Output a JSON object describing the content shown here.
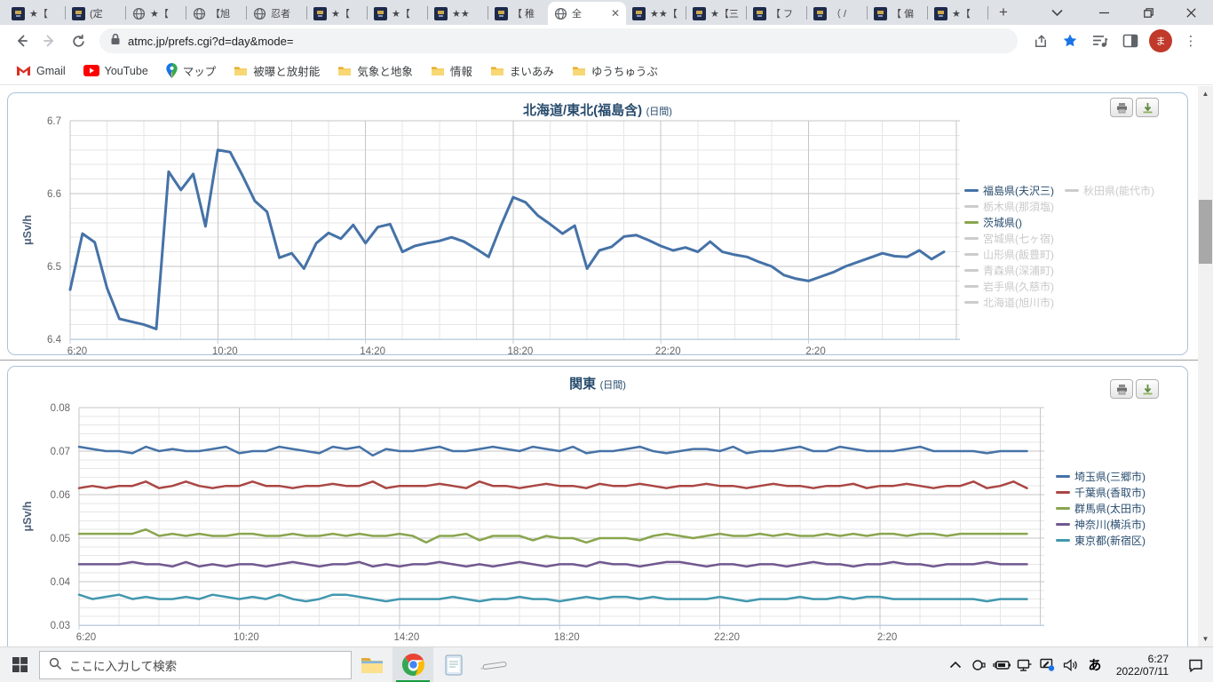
{
  "browser": {
    "tabs": [
      {
        "label": "★【",
        "icon": "site"
      },
      {
        "label": "(定",
        "icon": "site"
      },
      {
        "label": "★【",
        "icon": "globe"
      },
      {
        "label": "【旭",
        "icon": "globe"
      },
      {
        "label": "忍者",
        "icon": "globe"
      },
      {
        "label": "★【",
        "icon": "site"
      },
      {
        "label": "★【",
        "icon": "site"
      },
      {
        "label": "★★",
        "icon": "site"
      },
      {
        "label": "【 稚",
        "icon": "site"
      },
      {
        "label": "全",
        "icon": "globe",
        "active": true
      },
      {
        "label": "★★【",
        "icon": "site"
      },
      {
        "label": "★【三",
        "icon": "site"
      },
      {
        "label": "【 フ",
        "icon": "site"
      },
      {
        "label": "（ /",
        "icon": "site"
      },
      {
        "label": "【 偏",
        "icon": "site"
      },
      {
        "label": "★【",
        "icon": "site"
      }
    ],
    "new_tab_label": "+",
    "url": "atmc.jp/prefs.cgi?d=day&mode=",
    "profile_initial": "ま",
    "bookmarks": [
      {
        "label": "Gmail",
        "icon": "gmail"
      },
      {
        "label": "YouTube",
        "icon": "youtube"
      },
      {
        "label": "マップ",
        "icon": "maps"
      },
      {
        "label": "被曝と放射能",
        "icon": "folder"
      },
      {
        "label": "気象と地象",
        "icon": "folder"
      },
      {
        "label": "情報",
        "icon": "folder"
      },
      {
        "label": "まいあみ",
        "icon": "folder"
      },
      {
        "label": "ゆうちゅうぶ",
        "icon": "folder"
      }
    ]
  },
  "chart_data": [
    {
      "type": "line",
      "title": "北海道/東北(福島含)",
      "title_suffix": "(日間)",
      "ylabel": "μSv/h",
      "ylim": [
        6.4,
        6.7
      ],
      "y_major_ticks": [
        "6.4",
        "6.5",
        "6.6",
        "6.7"
      ],
      "y_minor_step": 0.02,
      "x_start": "6:20",
      "x_interval_min": 20,
      "x_total_hours": 24.1,
      "x_tick_hours": [
        0,
        4,
        8,
        12,
        16,
        20
      ],
      "x_tick_labels": [
        "6:20",
        "10:20",
        "14:20",
        "18:20",
        "22:20",
        "2:20"
      ],
      "grid": true,
      "legend_position": "right",
      "series": [
        {
          "name": "福島県(夫沢三)",
          "color": "#4572A7",
          "values": [
            6.468,
            6.545,
            6.533,
            6.47,
            6.428,
            6.424,
            6.42,
            6.414,
            6.63,
            6.605,
            6.627,
            6.555,
            6.66,
            6.657,
            6.625,
            6.59,
            6.575,
            6.512,
            6.518,
            6.497,
            6.532,
            6.546,
            6.538,
            6.557,
            6.532,
            6.554,
            6.558,
            6.52,
            6.528,
            6.532,
            6.535,
            6.54,
            6.534,
            6.524,
            6.513,
            6.556,
            6.595,
            6.588,
            6.57,
            6.558,
            6.545,
            6.556,
            6.497,
            6.522,
            6.527,
            6.541,
            6.543,
            6.536,
            6.528,
            6.522,
            6.526,
            6.52,
            6.534,
            6.52,
            6.516,
            6.513,
            6.506,
            6.5,
            6.488,
            6.483,
            6.48,
            6.486,
            6.492,
            6.5,
            6.506,
            6.512,
            6.518,
            6.514,
            6.513,
            6.522,
            6.51,
            6.52
          ]
        }
      ],
      "legend": [
        {
          "label": "福島県(夫沢三)",
          "color": "#4572A7",
          "active": true,
          "column": 1
        },
        {
          "label": "秋田県(能代市)",
          "color": "#cccccc",
          "active": false,
          "column": 2
        },
        {
          "label": "栃木県(那須塩)",
          "color": "#cccccc",
          "active": false,
          "column": 1
        },
        {
          "label": "茨城県()",
          "color": "#89A54E",
          "active": true,
          "column": 1
        },
        {
          "label": "宮城県(七ヶ宿)",
          "color": "#cccccc",
          "active": false,
          "column": 1
        },
        {
          "label": "山形県(飯豊町)",
          "color": "#cccccc",
          "active": false,
          "column": 1
        },
        {
          "label": "青森県(深浦町)",
          "color": "#cccccc",
          "active": false,
          "column": 1
        },
        {
          "label": "岩手県(久慈市)",
          "color": "#cccccc",
          "active": false,
          "column": 1
        },
        {
          "label": "北海道(旭川市)",
          "color": "#cccccc",
          "active": false,
          "column": 1
        }
      ]
    },
    {
      "type": "line",
      "title": "関東",
      "title_suffix": "(日間)",
      "ylabel": "μSv/h",
      "ylim": [
        0.03,
        0.08
      ],
      "y_major_ticks": [
        "0.03",
        "0.04",
        "0.05",
        "0.06",
        "0.07",
        "0.08"
      ],
      "y_minor_step": 0.002,
      "x_start": "6:20",
      "x_interval_min": 20,
      "x_total_hours": 24.1,
      "x_tick_hours": [
        0,
        4,
        8,
        12,
        16,
        20
      ],
      "x_tick_labels": [
        "6:20",
        "10:20",
        "14:20",
        "18:20",
        "22:20",
        "2:20"
      ],
      "grid": true,
      "legend_position": "right",
      "series": [
        {
          "name": "埼玉県(三郷市)",
          "color": "#4572A7",
          "values": [
            0.071,
            0.0705,
            0.07,
            0.07,
            0.0695,
            0.071,
            0.07,
            0.0705,
            0.07,
            0.07,
            0.0705,
            0.071,
            0.0695,
            0.07,
            0.07,
            0.071,
            0.0705,
            0.07,
            0.0695,
            0.071,
            0.0705,
            0.071,
            0.069,
            0.0705,
            0.07,
            0.07,
            0.0705,
            0.071,
            0.07,
            0.07,
            0.0705,
            0.071,
            0.0705,
            0.07,
            0.071,
            0.0705,
            0.07,
            0.071,
            0.0695,
            0.07,
            0.07,
            0.0705,
            0.071,
            0.07,
            0.0695,
            0.07,
            0.0705,
            0.0705,
            0.07,
            0.071,
            0.0695,
            0.07,
            0.07,
            0.0705,
            0.071,
            0.07,
            0.07,
            0.071,
            0.0705,
            0.07,
            0.07,
            0.07,
            0.0705,
            0.071,
            0.07,
            0.07,
            0.07,
            0.07,
            0.0695,
            0.07,
            0.07,
            0.07
          ]
        },
        {
          "name": "千葉県(香取市)",
          "color": "#AA4643",
          "values": [
            0.0615,
            0.062,
            0.0615,
            0.062,
            0.062,
            0.063,
            0.0615,
            0.062,
            0.063,
            0.062,
            0.0615,
            0.062,
            0.062,
            0.063,
            0.062,
            0.062,
            0.0615,
            0.062,
            0.062,
            0.0625,
            0.062,
            0.062,
            0.063,
            0.0615,
            0.062,
            0.062,
            0.062,
            0.0625,
            0.062,
            0.0615,
            0.063,
            0.062,
            0.062,
            0.0615,
            0.062,
            0.0625,
            0.062,
            0.062,
            0.0615,
            0.0625,
            0.062,
            0.062,
            0.0625,
            0.062,
            0.0615,
            0.062,
            0.062,
            0.0625,
            0.062,
            0.062,
            0.0615,
            0.062,
            0.0625,
            0.062,
            0.062,
            0.0615,
            0.062,
            0.062,
            0.0625,
            0.0615,
            0.062,
            0.062,
            0.0625,
            0.062,
            0.0615,
            0.062,
            0.062,
            0.063,
            0.0615,
            0.062,
            0.063,
            0.0615
          ]
        },
        {
          "name": "群馬県(太田市)",
          "color": "#89A54E",
          "values": [
            0.051,
            0.051,
            0.051,
            0.051,
            0.051,
            0.052,
            0.0505,
            0.051,
            0.0505,
            0.051,
            0.0505,
            0.0505,
            0.051,
            0.051,
            0.0505,
            0.0505,
            0.051,
            0.0505,
            0.0505,
            0.051,
            0.0505,
            0.051,
            0.0505,
            0.0505,
            0.051,
            0.0505,
            0.049,
            0.0505,
            0.0505,
            0.051,
            0.0495,
            0.0505,
            0.0505,
            0.0505,
            0.0495,
            0.0505,
            0.05,
            0.05,
            0.049,
            0.05,
            0.05,
            0.05,
            0.0495,
            0.0505,
            0.051,
            0.0505,
            0.05,
            0.0505,
            0.051,
            0.0505,
            0.0505,
            0.051,
            0.0505,
            0.051,
            0.0505,
            0.0505,
            0.051,
            0.0505,
            0.051,
            0.0505,
            0.051,
            0.051,
            0.0505,
            0.051,
            0.051,
            0.0505,
            0.051,
            0.051,
            0.051,
            0.051,
            0.051,
            0.051
          ]
        },
        {
          "name": "神奈川(横浜市)",
          "color": "#71588F",
          "values": [
            0.044,
            0.044,
            0.044,
            0.044,
            0.0445,
            0.044,
            0.044,
            0.0435,
            0.0445,
            0.0435,
            0.044,
            0.0435,
            0.044,
            0.044,
            0.0435,
            0.044,
            0.0445,
            0.044,
            0.0435,
            0.044,
            0.044,
            0.0445,
            0.0435,
            0.044,
            0.0435,
            0.044,
            0.044,
            0.0445,
            0.044,
            0.0435,
            0.044,
            0.0435,
            0.044,
            0.0445,
            0.044,
            0.0435,
            0.044,
            0.044,
            0.0435,
            0.0445,
            0.044,
            0.044,
            0.0435,
            0.044,
            0.0445,
            0.0445,
            0.044,
            0.0435,
            0.044,
            0.044,
            0.0435,
            0.044,
            0.044,
            0.0435,
            0.044,
            0.0445,
            0.044,
            0.044,
            0.0435,
            0.044,
            0.044,
            0.0445,
            0.044,
            0.044,
            0.0435,
            0.044,
            0.044,
            0.044,
            0.0445,
            0.044,
            0.044,
            0.044
          ]
        },
        {
          "name": "東京都(新宿区)",
          "color": "#4198AF",
          "values": [
            0.037,
            0.036,
            0.0365,
            0.037,
            0.036,
            0.0365,
            0.036,
            0.036,
            0.0365,
            0.036,
            0.037,
            0.0365,
            0.036,
            0.0365,
            0.036,
            0.037,
            0.036,
            0.0355,
            0.036,
            0.037,
            0.037,
            0.0365,
            0.036,
            0.0355,
            0.036,
            0.036,
            0.036,
            0.036,
            0.0365,
            0.036,
            0.0355,
            0.036,
            0.036,
            0.0365,
            0.036,
            0.036,
            0.0355,
            0.036,
            0.0365,
            0.036,
            0.0365,
            0.0365,
            0.036,
            0.0365,
            0.036,
            0.036,
            0.036,
            0.036,
            0.0365,
            0.036,
            0.0355,
            0.036,
            0.036,
            0.036,
            0.0365,
            0.036,
            0.036,
            0.0365,
            0.036,
            0.0365,
            0.0365,
            0.036,
            0.036,
            0.036,
            0.036,
            0.036,
            0.036,
            0.036,
            0.0355,
            0.036,
            0.036,
            0.036
          ]
        }
      ],
      "legend": [
        {
          "label": "埼玉県(三郷市)",
          "color": "#4572A7",
          "active": true,
          "column": 1
        },
        {
          "label": "千葉県(香取市)",
          "color": "#AA4643",
          "active": true,
          "column": 1
        },
        {
          "label": "群馬県(太田市)",
          "color": "#89A54E",
          "active": true,
          "column": 1
        },
        {
          "label": "神奈川(横浜市)",
          "color": "#71588F",
          "active": true,
          "column": 1
        },
        {
          "label": "東京都(新宿区)",
          "color": "#4198AF",
          "active": true,
          "column": 1
        }
      ]
    }
  ],
  "taskbar": {
    "search_placeholder": "ここに入力して検索",
    "app_icons": [
      "explorer",
      "chrome",
      "notepad",
      "pen"
    ],
    "active_app": "chrome",
    "tray_icons": [
      "chevron-up-icon",
      "tablet-icon",
      "battery-icon",
      "network-icon",
      "ink-workspace-icon",
      "speaker-icon"
    ],
    "ime_indicator": "あ",
    "clock": {
      "time": "6:27",
      "date": "2022/07/11"
    }
  }
}
